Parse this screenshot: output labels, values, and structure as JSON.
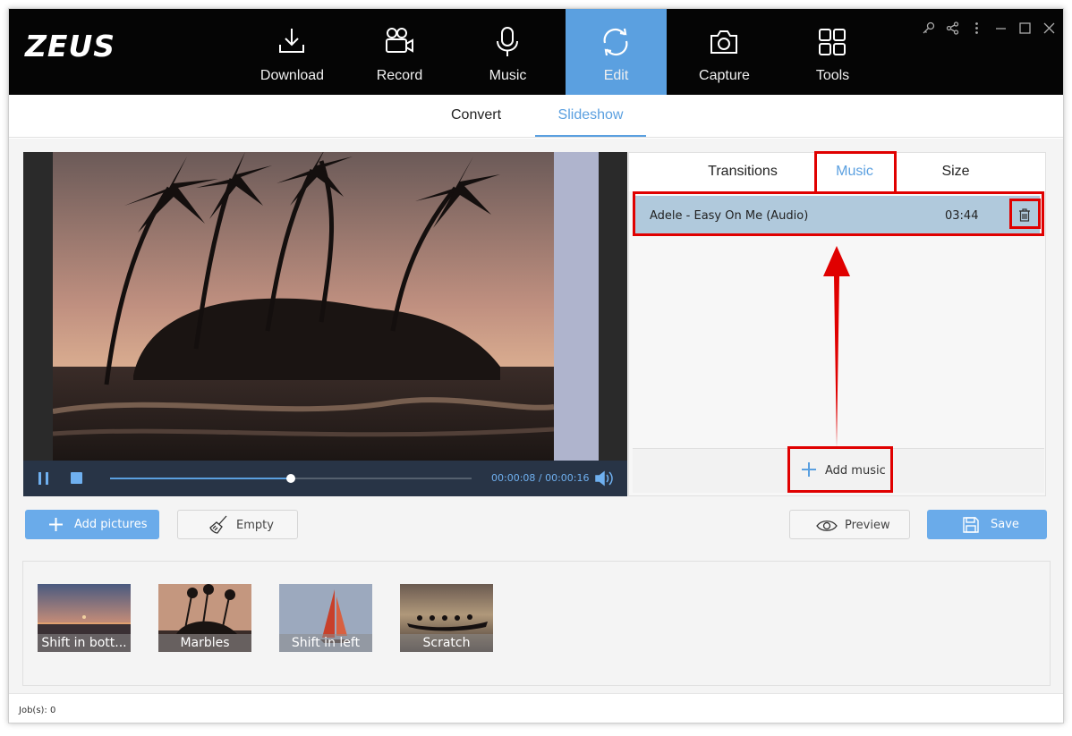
{
  "app": {
    "logo": "ZEUS"
  },
  "nav": [
    {
      "label": "Download",
      "icon": "download-icon"
    },
    {
      "label": "Record",
      "icon": "video-camera-icon"
    },
    {
      "label": "Music",
      "icon": "microphone-icon"
    },
    {
      "label": "Edit",
      "icon": "refresh-icon",
      "active": true
    },
    {
      "label": "Capture",
      "icon": "camera-icon"
    },
    {
      "label": "Tools",
      "icon": "grid-icon"
    }
  ],
  "subtabs": [
    {
      "label": "Convert"
    },
    {
      "label": "Slideshow",
      "active": true
    }
  ],
  "player": {
    "time": "00:00:08 / 00:00:16",
    "progress": 0.5
  },
  "right_panel": {
    "tabs": [
      {
        "label": "Transitions"
      },
      {
        "label": "Music",
        "active": true
      },
      {
        "label": "Size"
      }
    ],
    "music_items": [
      {
        "title": "Adele - Easy On Me (Audio)",
        "duration": "03:44"
      }
    ],
    "add_music_label": "Add music"
  },
  "actions": {
    "add_pictures": "Add pictures",
    "empty": "Empty",
    "preview": "Preview",
    "save": "Save"
  },
  "thumbnails": [
    {
      "caption": "Shift in bott..."
    },
    {
      "caption": "Marbles"
    },
    {
      "caption": "Shift in left"
    },
    {
      "caption": "Scratch"
    }
  ],
  "status": {
    "jobs": "Job(s): 0"
  },
  "colors": {
    "accent": "#5ba0e0",
    "annotation": "#e00000",
    "topbar": "#050505"
  }
}
